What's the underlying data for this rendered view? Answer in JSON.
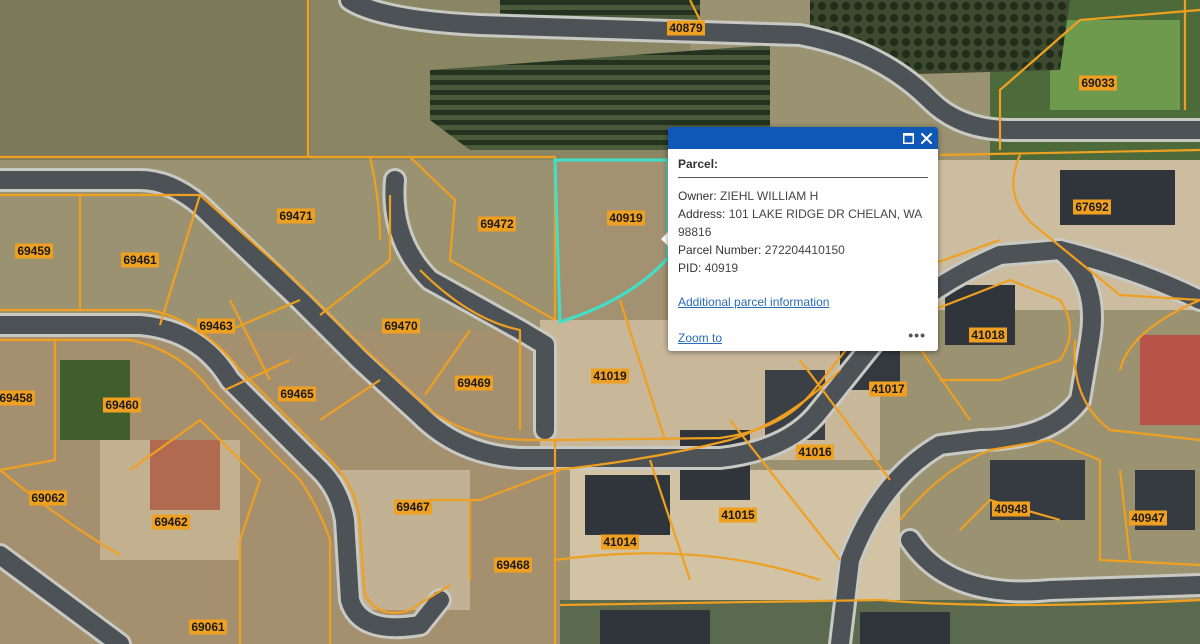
{
  "colors": {
    "parcel_line": "#f0a020",
    "selected_outline": "#3fe0c8",
    "road": "#4d5256",
    "road_edge": "#c9c9c4",
    "popup_header": "#0f58b8",
    "link": "#2a6bb8"
  },
  "parcel_labels": [
    {
      "id": "40879"
    },
    {
      "id": "69033"
    },
    {
      "id": "69471"
    },
    {
      "id": "69472"
    },
    {
      "id": "40919"
    },
    {
      "id": "69459"
    },
    {
      "id": "69461"
    },
    {
      "id": "67692"
    },
    {
      "id": "69463"
    },
    {
      "id": "69470"
    },
    {
      "id": "41018"
    },
    {
      "id": "69469"
    },
    {
      "id": "41019"
    },
    {
      "id": "41017"
    },
    {
      "id": "69458"
    },
    {
      "id": "69460"
    },
    {
      "id": "69465"
    },
    {
      "id": "41016"
    },
    {
      "id": "69062"
    },
    {
      "id": "69467"
    },
    {
      "id": "40948"
    },
    {
      "id": "40947"
    },
    {
      "id": "69462"
    },
    {
      "id": "41015"
    },
    {
      "id": "41014"
    },
    {
      "id": "69468"
    },
    {
      "id": "69061"
    }
  ],
  "popup": {
    "title": "Parcel:",
    "owner_label": "Owner:",
    "owner_value": "ZIEHL WILLIAM H",
    "address_label": "Address:",
    "address_value": "101 LAKE RIDGE DR CHELAN, WA 98816",
    "parcel_number_label": "Parcel Number:",
    "parcel_number_value": "272204410150",
    "pid_label": "PID:",
    "pid_value": "40919",
    "more_info_link": "Additional parcel information",
    "zoom_link": "Zoom to",
    "more_actions": "•••",
    "maximize_icon": "maximize-icon",
    "close_icon": "close-icon"
  }
}
